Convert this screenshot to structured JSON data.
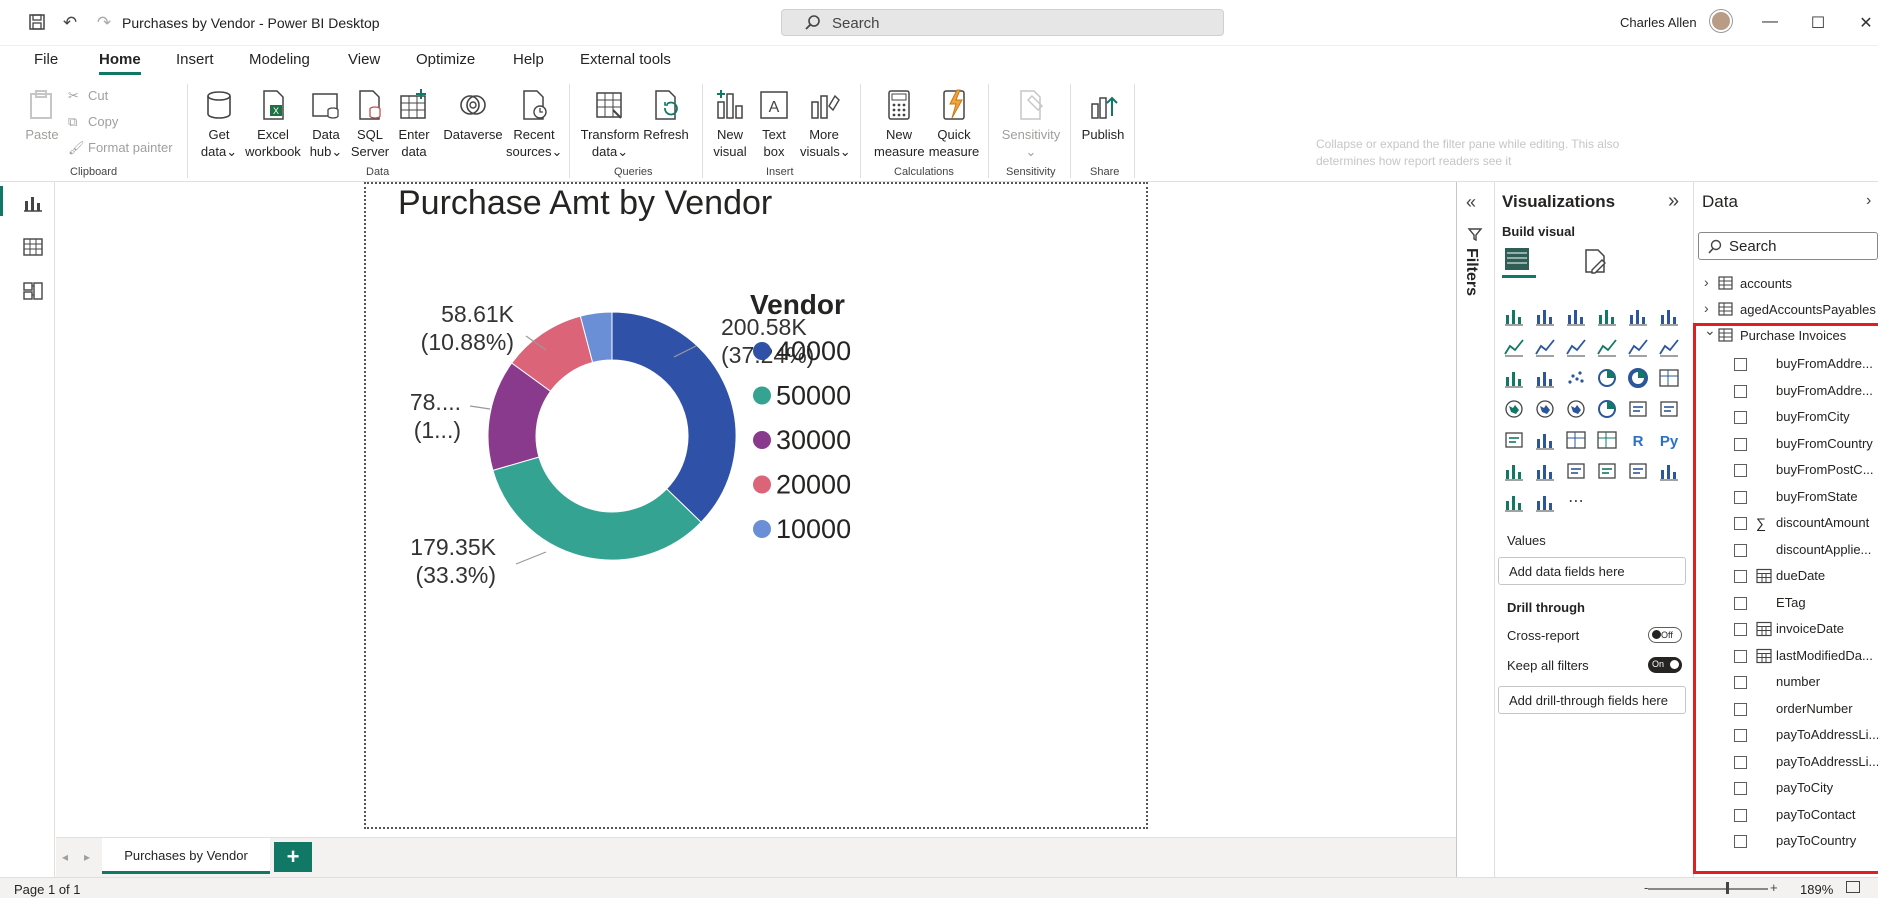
{
  "window": {
    "title": "Purchases by Vendor - Power BI Desktop",
    "search_label": "Search",
    "user_name": "Charles Allen"
  },
  "menu": {
    "file": "File",
    "home": "Home",
    "insert": "Insert",
    "modeling": "Modeling",
    "view": "View",
    "optimize": "Optimize",
    "help": "Help",
    "external_tools": "External tools"
  },
  "ribbon": {
    "clipboard": {
      "paste": "Paste",
      "cut": "Cut",
      "copy": "Copy",
      "format_painter": "Format painter",
      "group": "Clipboard"
    },
    "data": {
      "get_data": [
        "Get",
        "data"
      ],
      "excel": [
        "Excel",
        "workbook"
      ],
      "data_hub": [
        "Data",
        "hub"
      ],
      "sql": [
        "SQL",
        "Server"
      ],
      "enter_data": [
        "Enter",
        "data"
      ],
      "dataverse": "Dataverse",
      "recent_sources": [
        "Recent",
        "sources"
      ],
      "group": "Data"
    },
    "queries": {
      "transform": [
        "Transform",
        "data"
      ],
      "refresh": "Refresh",
      "group": "Queries"
    },
    "insert": {
      "new_visual": [
        "New",
        "visual"
      ],
      "text_box": [
        "Text",
        "box"
      ],
      "more_visuals": [
        "More",
        "visuals"
      ],
      "group": "Insert"
    },
    "calculations": {
      "new_measure": [
        "New",
        "measure"
      ],
      "quick_measure": [
        "Quick",
        "measure"
      ],
      "group": "Calculations"
    },
    "sensitivity": {
      "label": "Sensitivity",
      "group": "Sensitivity"
    },
    "share": {
      "publish": "Publish",
      "group": "Share"
    },
    "tooltip": "Collapse or expand the filter pane while editing. This also determines how report readers see it"
  },
  "chart_data": {
    "type": "pie",
    "title": "Purchase Amt by Vendor",
    "legend_title": "Vendor",
    "legend_position": "right",
    "donut": true,
    "series": [
      {
        "name": "40000",
        "value": 200.58,
        "label": "200.58K",
        "percent_label": "(37.24%)",
        "color": "#2F52A8"
      },
      {
        "name": "50000",
        "value": 179.35,
        "label": "179.35K",
        "percent_label": "(33.3%)",
        "color": "#34A391"
      },
      {
        "name": "30000",
        "value": 78.0,
        "label": "78....",
        "percent_label": "(1...)",
        "color": "#8A3A8C"
      },
      {
        "name": "20000",
        "value": 58.61,
        "label": "58.61K",
        "percent_label": "(10.88%)",
        "color": "#DB6479"
      },
      {
        "name": "10000",
        "value": 22.1,
        "label": "",
        "percent_label": "",
        "color": "#6A8FD6"
      }
    ]
  },
  "filters": {
    "label": "Filters"
  },
  "visualizations": {
    "title": "Visualizations",
    "build_visual": "Build visual",
    "values_label": "Values",
    "values_placeholder": "Add data fields here",
    "drill_through": "Drill through",
    "cross_report": "Cross-report",
    "cross_report_state": "Off",
    "keep_all_filters": "Keep all filters",
    "keep_all_filters_state": "On",
    "drill_placeholder": "Add drill-through fields here"
  },
  "data_pane": {
    "title": "Data",
    "search_placeholder": "Search",
    "tables": [
      {
        "name": "accounts"
      },
      {
        "name": "agedAccountsPayables"
      },
      {
        "name": "Purchase Invoices"
      }
    ],
    "fields": [
      {
        "name": "buyFromAddre...",
        "icon": "",
        "expandable": false
      },
      {
        "name": "buyFromAddre...",
        "icon": "",
        "expandable": false
      },
      {
        "name": "buyFromCity",
        "icon": "",
        "expandable": false
      },
      {
        "name": "buyFromCountry",
        "icon": "",
        "expandable": false
      },
      {
        "name": "buyFromPostC...",
        "icon": "",
        "expandable": false
      },
      {
        "name": "buyFromState",
        "icon": "",
        "expandable": false
      },
      {
        "name": "discountAmount",
        "icon": "sigma-icon",
        "expandable": false
      },
      {
        "name": "discountApplie...",
        "icon": "",
        "expandable": false
      },
      {
        "name": "dueDate",
        "icon": "calendar-icon",
        "expandable": true
      },
      {
        "name": "ETag",
        "icon": "",
        "expandable": false
      },
      {
        "name": "invoiceDate",
        "icon": "calendar-icon",
        "expandable": true
      },
      {
        "name": "lastModifiedDa...",
        "icon": "calendar-icon",
        "expandable": true
      },
      {
        "name": "number",
        "icon": "",
        "expandable": false
      },
      {
        "name": "orderNumber",
        "icon": "",
        "expandable": false
      },
      {
        "name": "payToAddressLi...",
        "icon": "",
        "expandable": false
      },
      {
        "name": "payToAddressLi...",
        "icon": "",
        "expandable": false
      },
      {
        "name": "payToCity",
        "icon": "",
        "expandable": false
      },
      {
        "name": "payToContact",
        "icon": "",
        "expandable": false
      },
      {
        "name": "payToCountry",
        "icon": "",
        "expandable": false
      }
    ]
  },
  "pages": {
    "tab": "Purchases by Vendor",
    "add": "+"
  },
  "status": {
    "page": "Page 1 of 1",
    "zoom": "189%"
  },
  "colors": {
    "accent": "#117865",
    "highlight": "#e02020"
  }
}
